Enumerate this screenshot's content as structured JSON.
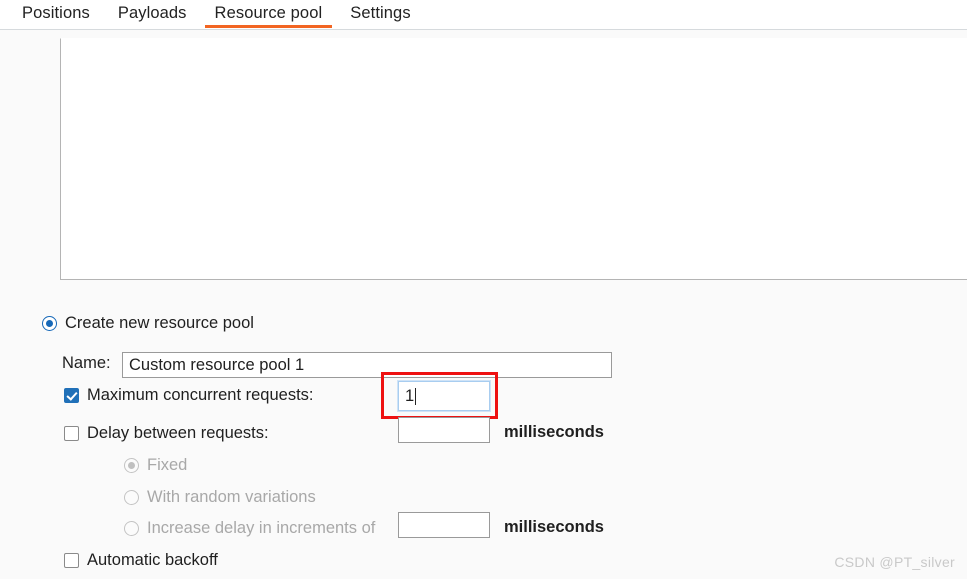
{
  "tabs": [
    {
      "label": "Positions",
      "active": false
    },
    {
      "label": "Payloads",
      "active": false
    },
    {
      "label": "Resource pool",
      "active": true
    },
    {
      "label": "Settings",
      "active": false
    }
  ],
  "accent_color": "#f26522",
  "select_color": "#1668b8",
  "form": {
    "create_pool_radio_label": "Create new resource pool",
    "name_label": "Name:",
    "name_value": "Custom resource pool 1",
    "max_concurrent_label": "Maximum concurrent requests:",
    "max_concurrent_value": "1",
    "delay_label": "Delay between requests:",
    "delay_value": "",
    "delay_unit": "milliseconds",
    "fixed_label": "Fixed",
    "random_label": "With random variations",
    "increase_label": "Increase delay in increments of",
    "increase_value": "",
    "increase_unit": "milliseconds",
    "automatic_backoff_label": "Automatic backoff"
  },
  "watermark": "CSDN @PT_silver"
}
